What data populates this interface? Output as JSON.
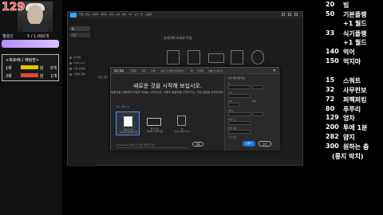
{
  "overlay": {
    "counter": "129",
    "streamer_name": "별용인",
    "sub_goal": "5 / 1,000개",
    "mission_title": "<복호배니 배팅받>",
    "mission_rows": [
      {
        "label": "1회",
        "amount": "원",
        "count": "0개"
      },
      {
        "label": "2회",
        "amount": "원",
        "count": "1개"
      }
    ]
  },
  "app": {
    "menus": [
      "파일",
      "편집",
      "이미지",
      "레이어",
      "문자",
      "선택",
      "필터",
      "3D",
      "보기",
      "창",
      "도움말"
    ],
    "sidebar": {
      "home": "홈",
      "new": "학습",
      "items": [
        "내 파일",
        "Lightroom",
        "나와 공유됨",
        "삭제된 항목"
      ]
    },
    "hero_text": "상세하여 보세요 작업",
    "recent_header": "최근 항목"
  },
  "dialog": {
    "tabs": [
      "최근 항목",
      "저장됨",
      "사진",
      "인쇄",
      "아트 및 일러스트레이션",
      "웹",
      "모바일",
      "필름 및 비디오"
    ],
    "close": "✕",
    "title": "새로운 것을 시작해 보십시오.",
    "subtitle": "템플릿을 사용하여 다양한 작업을 시작하세요. 아래의 템플릿을 선택하거나, 직접 설정을 입력하세요.",
    "presets_label": "최근 항목 (3)",
    "presets": [
      {
        "name": "사용자 정의",
        "size": "1920 x 1080 픽셀"
      },
      {
        "name": "웹 이미지",
        "size": "1366 x 768 픽셀"
      },
      {
        "name": "A4",
        "size": "210 x 297 mm"
      }
    ],
    "search_placeholder": "Adobe Stock에서 더 많은 템플릿 찾기",
    "go_label": "이동",
    "props": {
      "header": "사전 설정 세부 정보",
      "fields": [
        "폭",
        "높이",
        "방향",
        "대지",
        "해상도",
        "색상 모드",
        "배경 내용",
        "고급 옵션"
      ],
      "create": "만들기",
      "close": "닫기"
    }
  },
  "right_list": [
    {
      "num": "20",
      "text": "빔"
    },
    {
      "num": "50",
      "text": "기본플랭"
    },
    {
      "num": "",
      "text": "+1 월드"
    },
    {
      "num": "33",
      "text": "식기플랭"
    },
    {
      "num": "",
      "text": "+1 월드"
    },
    {
      "num": "140",
      "text": "먹어"
    },
    {
      "num": "150",
      "text": "먹지마"
    },
    {
      "num": "15",
      "text": "스쿼트"
    },
    {
      "num": "32",
      "text": "사무란보"
    },
    {
      "num": "72",
      "text": "퍼펙퍼킹"
    },
    {
      "num": "80",
      "text": "푸쭈리"
    },
    {
      "num": "129",
      "text": "엉차"
    },
    {
      "num": "200",
      "text": "투에 1분"
    },
    {
      "num": "282",
      "text": "얌지"
    },
    {
      "num": "300",
      "text": "원하는 춤"
    },
    {
      "num": "",
      "text": "(롱지 박치)"
    }
  ],
  "colors": {
    "accent": "#1473e6",
    "counter": "#ff3b3b",
    "sub_bar": "#b48cff",
    "ps_blue": "#31a8ff"
  }
}
